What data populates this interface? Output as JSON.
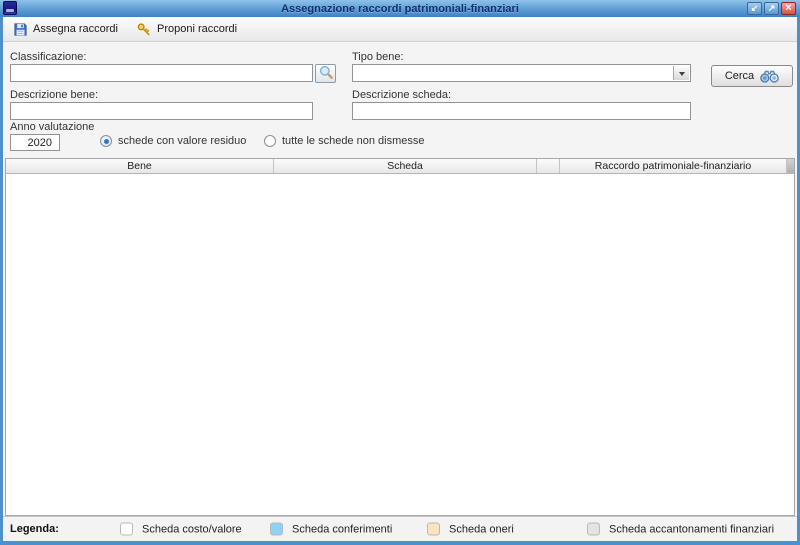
{
  "window": {
    "title": "Assegnazione raccordi patrimoniali-finanziari",
    "controls": {
      "restore_glyph": "↙",
      "maximize_glyph": "↗",
      "close_glyph": "×"
    }
  },
  "toolbar": {
    "assegna_button": "Assegna raccordi",
    "proponi_button": "Proponi raccordi"
  },
  "form": {
    "classificazione_label": "Classificazione:",
    "classificazione_value": "",
    "tipo_bene_label": "Tipo bene:",
    "tipo_bene_value": "",
    "cerca_button": "Cerca",
    "descrizione_bene_label": "Descrizione bene:",
    "descrizione_bene_value": "",
    "descrizione_scheda_label": "Descrizione scheda:",
    "descrizione_scheda_value": "",
    "anno_valutazione_label": "Anno valutazione",
    "anno_valutazione_value": "2020",
    "filter_options": [
      {
        "label": "schede con valore residuo",
        "selected": true
      },
      {
        "label": "tutte le schede non dismesse",
        "selected": false
      }
    ]
  },
  "table": {
    "columns": [
      "Bene",
      "Scheda",
      "",
      "Raccordo patrimoniale-finanziario"
    ],
    "rows": []
  },
  "legend": {
    "title": "Legenda:",
    "items": [
      {
        "label": "Scheda costo/valore",
        "color": "#ffffff"
      },
      {
        "label": "Scheda conferimenti",
        "color": "#8dd4f4"
      },
      {
        "label": "Scheda oneri",
        "color": "#fbe3bd"
      },
      {
        "label": "Scheda accantonamenti finanziari",
        "color": "#e3e3e3"
      }
    ]
  }
}
